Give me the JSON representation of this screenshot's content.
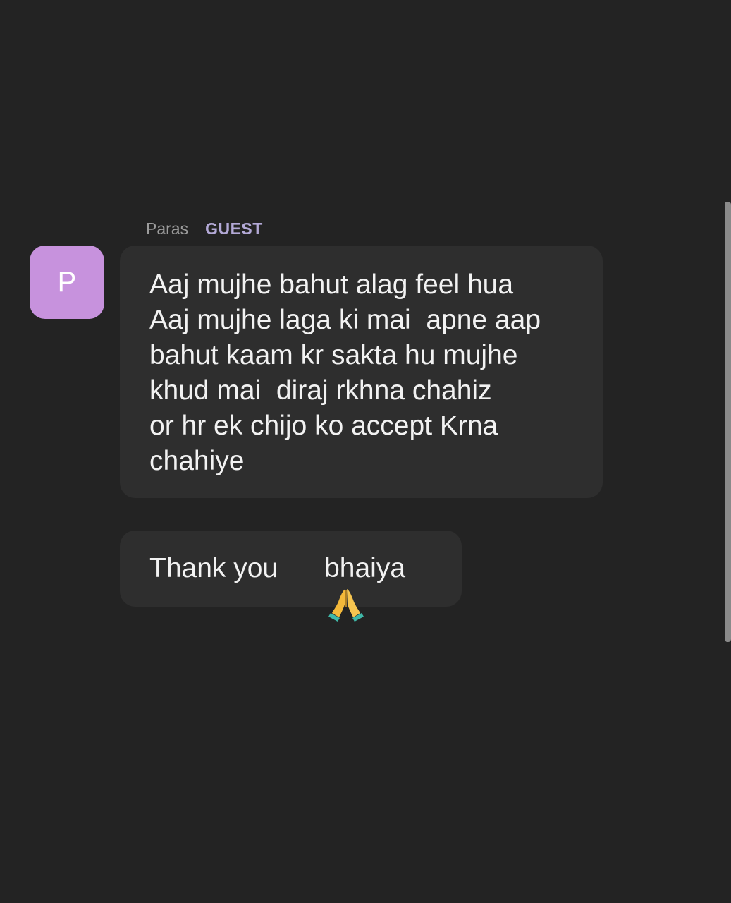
{
  "colors": {
    "background": "#232323",
    "bubble": "#2e2e2e",
    "avatar": "#c792dd",
    "role_accent": "#b3a9d6",
    "scrollbar": "#8a8a8a"
  },
  "sender": {
    "name": "Paras",
    "role": "GUEST",
    "avatar_initial": "P"
  },
  "messages": [
    {
      "lines": [
        "Aaj mujhe bahut alag feel hua",
        "Aaj mujhe laga ki mai  apne aap",
        "bahut kaam kr sakta hu mujhe",
        "khud mai  diraj rkhna chahiz",
        "or hr ek chijo ko accept Krna",
        "chahiye"
      ]
    },
    {
      "text_before_icon": "Thank you",
      "icon": "folded-hands-icon",
      "text_after_icon": "bhaiya"
    }
  ]
}
